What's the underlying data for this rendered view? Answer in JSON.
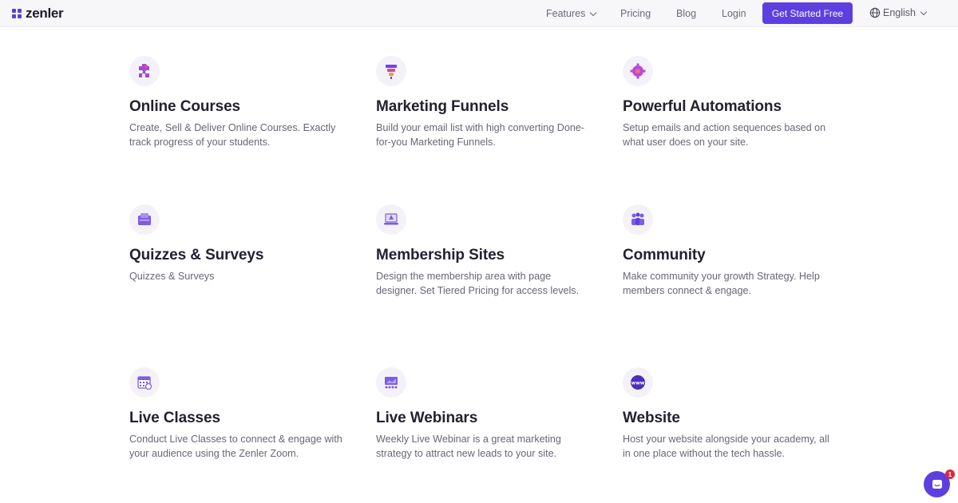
{
  "brand": {
    "name": "zenler",
    "color": "#5b3fd6"
  },
  "nav": {
    "features": "Features",
    "pricing": "Pricing",
    "blog": "Blog",
    "login": "Login",
    "cta": "Get Started Free",
    "language": "English"
  },
  "features": [
    {
      "icon": "puzzle-icon",
      "title": "Online Courses",
      "desc": "Create, Sell & Deliver Online Courses. Exactly track progress of your students."
    },
    {
      "icon": "funnel-icon",
      "title": "Marketing Funnels",
      "desc": "Build your email list with high converting Done-for-you Marketing Funnels."
    },
    {
      "icon": "gear-icon",
      "title": "Powerful Automations",
      "desc": "Setup emails and action sequences based on what user does on your site."
    },
    {
      "icon": "quiz-folder-icon",
      "title": "Quizzes & Surveys",
      "desc": "Quizzes & Surveys"
    },
    {
      "icon": "laptop-icon",
      "title": "Membership Sites",
      "desc": "Design the membership area with page designer. Set Tiered Pricing for access levels."
    },
    {
      "icon": "people-icon",
      "title": "Community",
      "desc": "Make community your growth Strategy. Help members connect & engage."
    },
    {
      "icon": "calendar-icon",
      "title": "Live Classes",
      "desc": "Conduct Live Classes to connect & engage with your audience using the Zenler Zoom."
    },
    {
      "icon": "webinar-screen-icon",
      "title": "Live Webinars",
      "desc": "Weekly Live Webinar is a great marketing strategy to attract new leads to your site."
    },
    {
      "icon": "www-globe-icon",
      "title": "Website",
      "desc": "Host your website alongside your academy, all in one place without the tech hassle."
    }
  ],
  "chat": {
    "badge": "1"
  },
  "colors": {
    "accent": "#5d3fe0",
    "badge": "#e0263e"
  }
}
